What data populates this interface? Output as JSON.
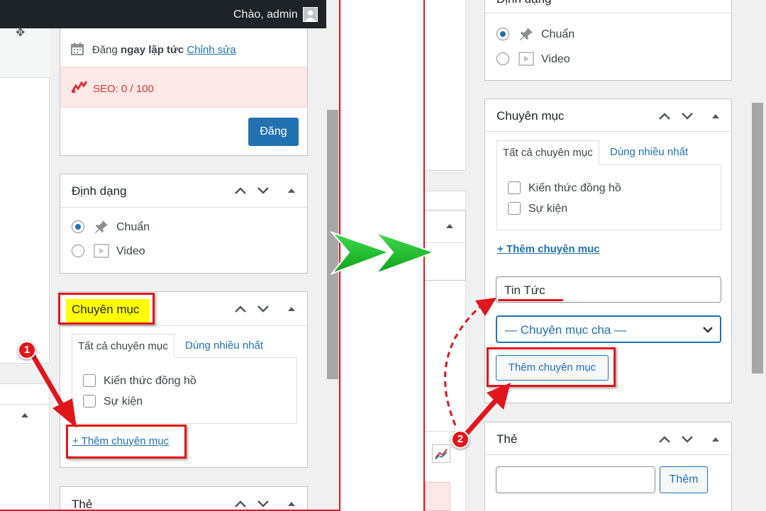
{
  "admin_bar": {
    "greeting": "Chào, admin"
  },
  "left": {
    "publish": {
      "schedule_prefix": "Đăng ",
      "schedule_bold": "ngay lập tức",
      "edit_link": "Chỉnh sửa",
      "seo": "SEO: 0 / 100",
      "publish_button": "Đăng"
    },
    "format_box": {
      "title": "Định dạng",
      "options": [
        "Chuẩn",
        "Video"
      ]
    },
    "category_box": {
      "title": "Chuyên mục",
      "tab_all": "Tất cả chuyên mục",
      "tab_popular": "Dùng nhiều nhất",
      "categories": [
        "Kiến thức đồng hồ",
        "Sự kiện"
      ],
      "add_link": "+ Thêm chuyên mục"
    },
    "tags_box": {
      "title": "Thẻ"
    }
  },
  "right": {
    "format_box": {
      "title": "Định dạng",
      "options": [
        "Chuẩn",
        "Video"
      ]
    },
    "category_box": {
      "title": "Chuyên mục",
      "tab_all": "Tất cả chuyên mục",
      "tab_popular": "Dùng nhiều nhất",
      "categories": [
        "Kiến thức đồng hồ",
        "Sự kiện"
      ],
      "add_link": "+ Thêm chuyên mục",
      "new_category_value": "Tin Tức",
      "parent_select": "— Chuyên mục cha —",
      "add_button": "Thêm chuyên mục"
    },
    "tags_box": {
      "title": "Thẻ",
      "add_button": "Thêm"
    }
  },
  "annotations": {
    "step1": "1",
    "step2": "2"
  },
  "colors": {
    "accent": "#2271b1",
    "annotation_red": "#e0161b",
    "arrow_green": "#1fc02f",
    "highlight": "#ffff00",
    "seo_bg": "#fde8e8"
  }
}
